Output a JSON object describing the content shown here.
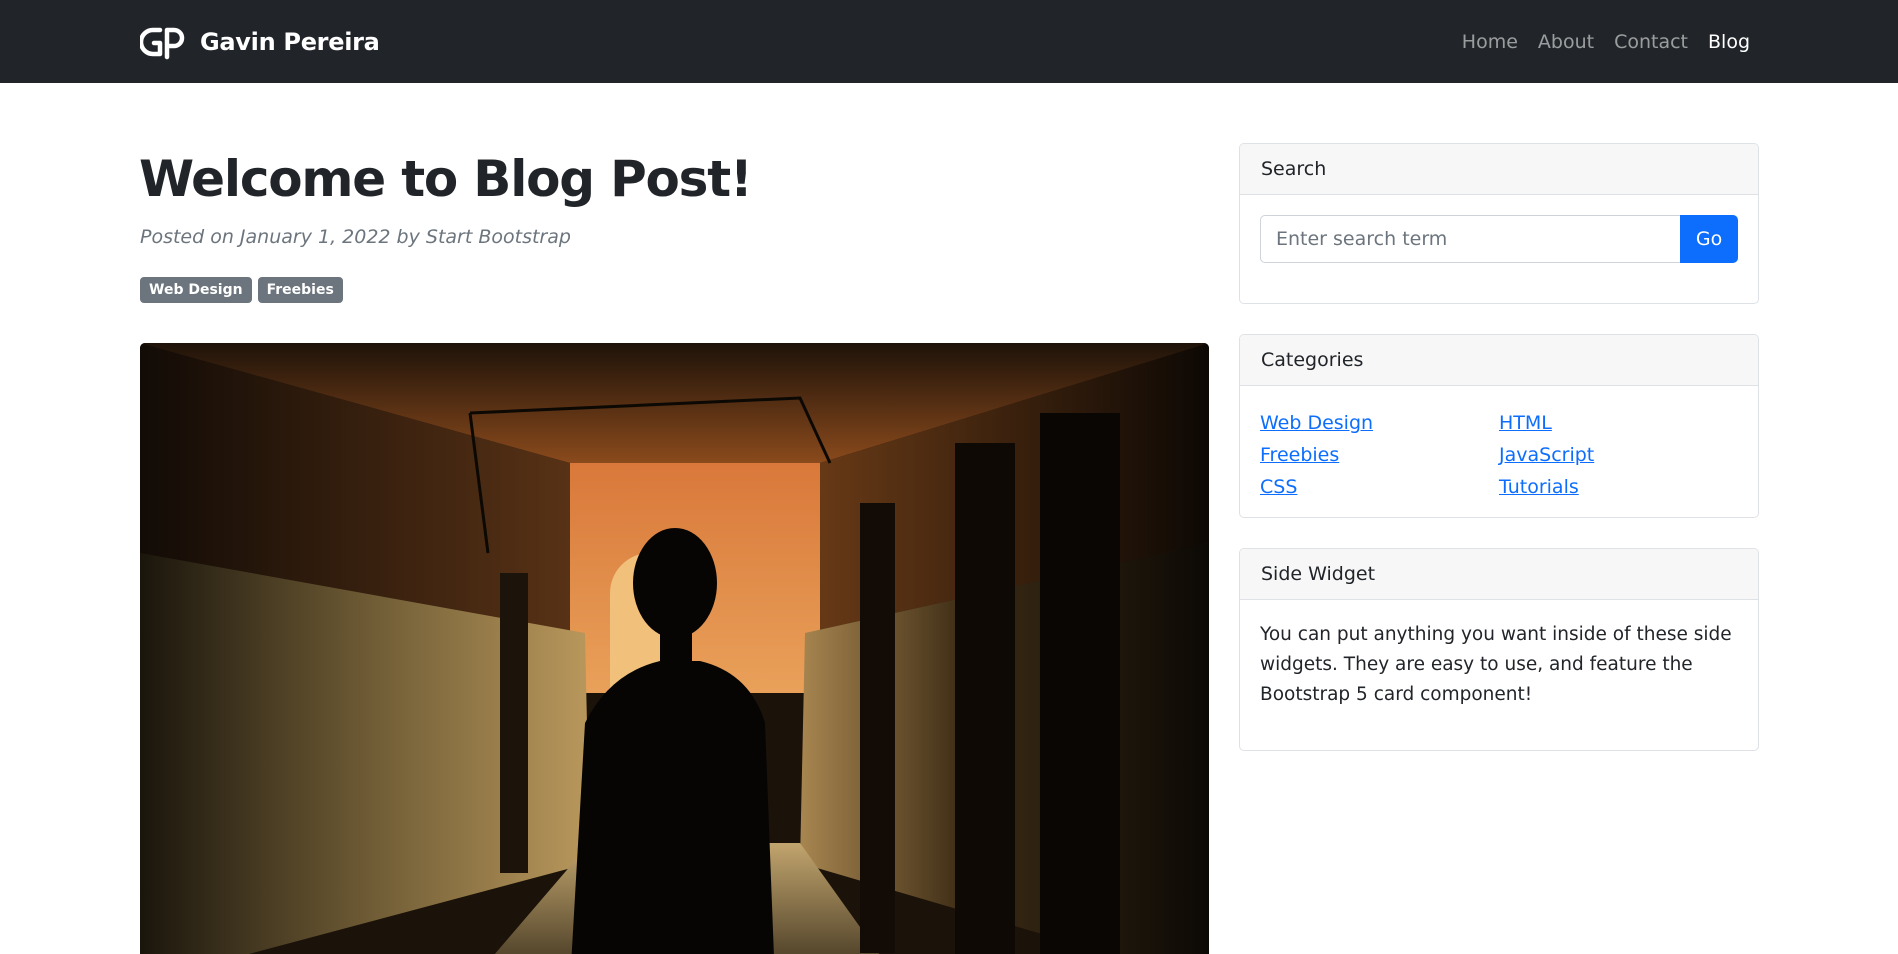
{
  "navbar": {
    "brand_name": "Gavin Pereira",
    "brand_logo": "gp-logo-icon",
    "links": [
      {
        "label": "Home",
        "active": false
      },
      {
        "label": "About",
        "active": false
      },
      {
        "label": "Contact",
        "active": false
      },
      {
        "label": "Blog",
        "active": true
      }
    ]
  },
  "post": {
    "title": "Welcome to Blog Post!",
    "meta": "Posted on January 1, 2022 by Start Bootstrap",
    "tags": [
      "Web Design",
      "Freebies"
    ],
    "image_icon": "hallway-photo"
  },
  "sidebar": {
    "search": {
      "header": "Search",
      "placeholder": "Enter search term",
      "value": "",
      "button_label": "Go"
    },
    "categories": {
      "header": "Categories",
      "left": [
        "Web Design",
        "Freebies",
        "CSS"
      ],
      "right": [
        "HTML",
        "JavaScript",
        "Tutorials"
      ]
    },
    "side_widget": {
      "header": "Side Widget",
      "text": "You can put anything you want inside of these side widgets. They are easy to use, and feature the Bootstrap 5 card component!"
    }
  },
  "colors": {
    "navbar_bg": "#212529",
    "primary": "#0d6efd",
    "badge_bg": "#6c757d",
    "muted_text": "#6c757d"
  }
}
